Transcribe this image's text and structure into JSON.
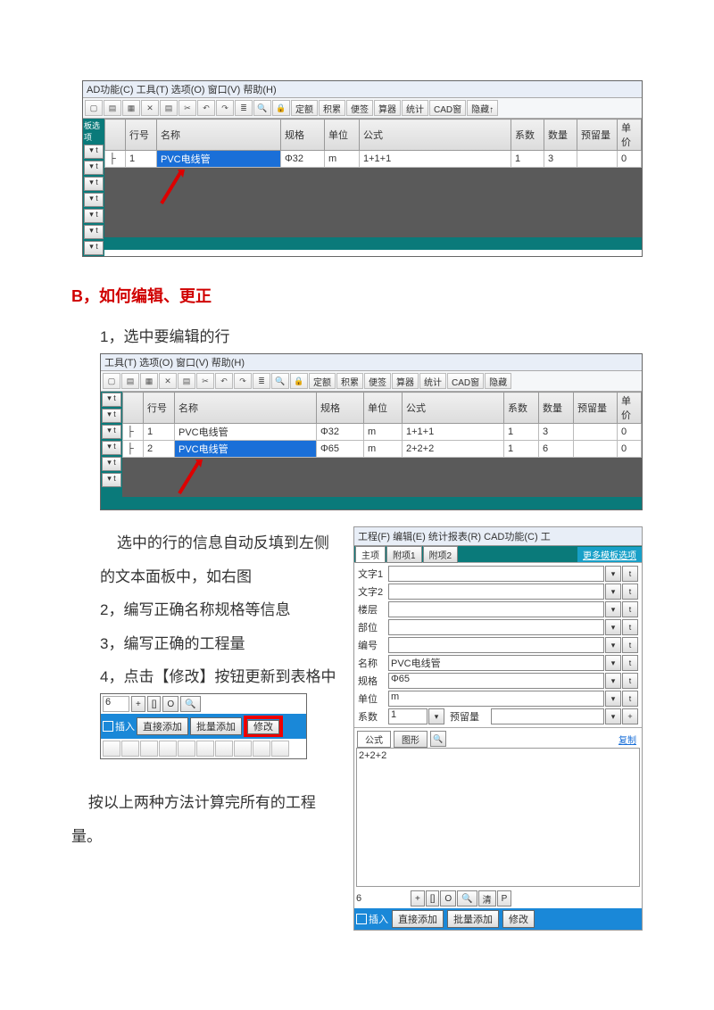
{
  "section_title": "B，如何编辑、更正",
  "steps": {
    "s1": "1，选中要编辑的行",
    "s_mid": "选中的行的信息自动反填到左侧的文本面板中，如右图",
    "s2": "2，编写正确名称规格等信息",
    "s3": "3，编写正确的工程量",
    "s4": "4，点击【修改】按钮更新到表格中",
    "s_end": "按以上两种方法计算完所有的工程量。"
  },
  "scr1": {
    "menu": "AD功能(C)  工具(T)  选项(O)  窗口(V)  帮助(H)",
    "left_label": "板选项",
    "tool_text_btns": [
      "定额",
      "积累",
      "便签",
      "算器",
      "统计",
      "CAD窗",
      "隐藏↑"
    ],
    "headers": [
      "",
      "行号",
      "名称",
      "规格",
      "单位",
      "公式",
      "系数",
      "数量",
      "预留量",
      "单价"
    ],
    "row": {
      "num": "1",
      "name": "PVC电线管",
      "spec": "Φ32",
      "unit": "m",
      "formula": "1+1+1",
      "coef": "1",
      "qty": "3",
      "reserve": "",
      "price": "0"
    }
  },
  "scr2": {
    "menu": "工具(T)  选项(O)  窗口(V)  帮助(H)",
    "tool_text_btns": [
      "定额",
      "积累",
      "便签",
      "算器",
      "统计",
      "CAD窗",
      "隐藏"
    ],
    "headers": [
      "",
      "行号",
      "名称",
      "规格",
      "单位",
      "公式",
      "系数",
      "数量",
      "预留量",
      "单价"
    ],
    "row1": {
      "num": "1",
      "name": "PVC电线管",
      "spec": "Φ32",
      "unit": "m",
      "formula": "1+1+1",
      "coef": "1",
      "qty": "3",
      "reserve": "",
      "price": "0"
    },
    "row2": {
      "num": "2",
      "name": "PVC电线管",
      "spec": "Φ65",
      "unit": "m",
      "formula": "2+2+2",
      "coef": "1",
      "qty": "6",
      "reserve": "",
      "price": "0"
    }
  },
  "panel": {
    "menu": "工程(F)  编辑(E)  统计报表(R)  CAD功能(C)  工",
    "tabs": {
      "t1": "主项",
      "t2": "附项1",
      "t3": "附项2",
      "more": "更多模板选项"
    },
    "fields": {
      "f1": "文字1",
      "f2": "文字2",
      "f3": "楼层",
      "f4": "部位",
      "f5": "编号",
      "f6": "名称",
      "f6v": "PVC电线管",
      "f7": "规格",
      "f7v": "Φ65",
      "f8": "单位",
      "f8v": "m",
      "f9": "系数",
      "f9v": "1",
      "f10": "预留量"
    },
    "formula_tabs": {
      "a": "公式",
      "b": "图形"
    },
    "copy": "复制",
    "formula_val": "2+2+2",
    "bottom_input": "6",
    "bbtns": [
      "+",
      "[]",
      "O",
      "🔍",
      "清",
      "P"
    ],
    "action": {
      "chk": "插入",
      "b1": "直接添加",
      "b2": "批量添加",
      "b3": "修改"
    }
  },
  "scr3": {
    "num": "6",
    "btns": [
      "+",
      "[]",
      "O",
      "🔍"
    ],
    "action": {
      "chk": "插入",
      "b1": "直接添加",
      "b2": "批量添加",
      "b3": "修改"
    }
  }
}
